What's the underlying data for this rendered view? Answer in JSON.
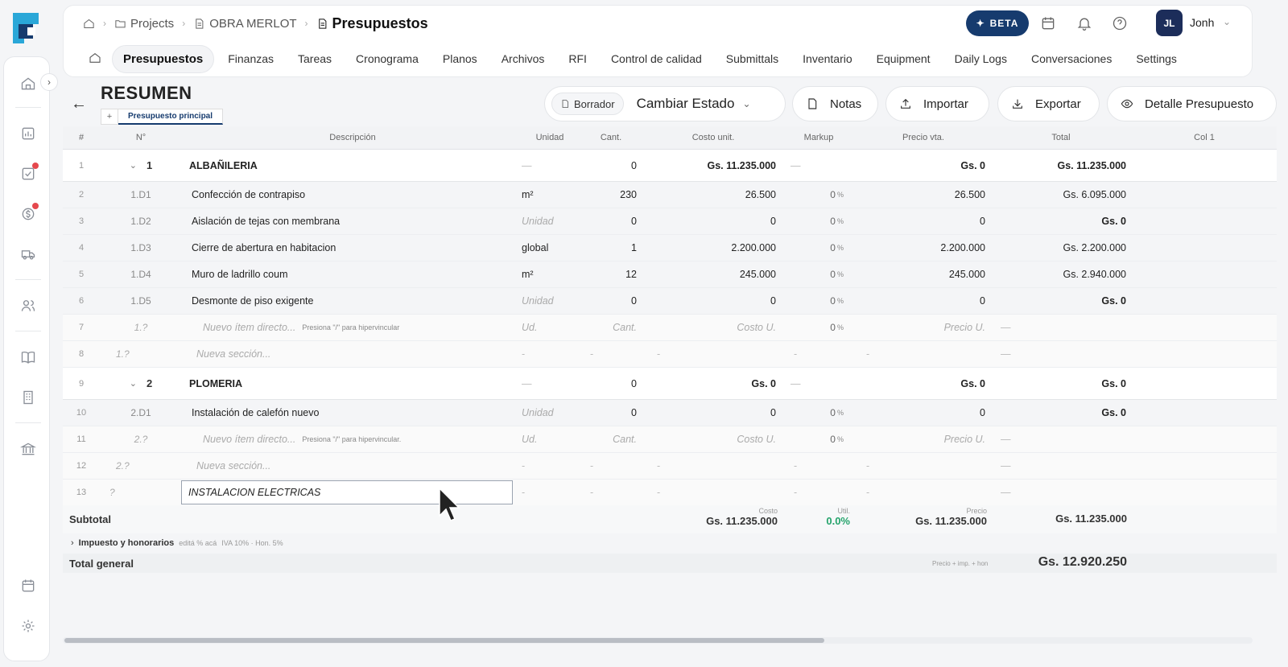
{
  "breadcrumb": {
    "projects": "Projects",
    "project": "OBRA MERLOT",
    "current": "Presupuestos"
  },
  "header": {
    "beta_label": "BETA",
    "avatar_initials": "JL",
    "user_name": "Jonh"
  },
  "tabs": [
    "Presupuestos",
    "Finanzas",
    "Tareas",
    "Cronograma",
    "Planos",
    "Archivos",
    "RFI",
    "Control de calidad",
    "Submittals",
    "Inventario",
    "Equipment",
    "Daily Logs",
    "Conversaciones",
    "Settings"
  ],
  "page": {
    "title": "RESUMEN",
    "subtab_add": "+",
    "subtab": "Presupuesto principal",
    "status_badge": "Borrador",
    "change_status": "Cambiar Estado"
  },
  "toolbar": {
    "notas": "Notas",
    "importar": "Importar",
    "exportar": "Exportar",
    "detalle": "Detalle Presupuesto"
  },
  "table": {
    "columns": {
      "idx": "#",
      "num": "N°",
      "desc": "Descripción",
      "unit": "Unidad",
      "cant": "Cant.",
      "costo": "Costo unit.",
      "markup": "Markup",
      "precio": "Precio vta.",
      "total": "Total",
      "col1": "Col 1"
    },
    "rows": [
      {
        "idx": "1",
        "num": "1",
        "desc": "ALBAÑILERIA",
        "unit": "—",
        "cant": "0",
        "costo": "Gs. 11.235.000",
        "markup": "—",
        "precio": "Gs. 0",
        "total": "Gs. 11.235.000"
      },
      {
        "idx": "2",
        "num": "1.D1",
        "desc": "Confección de contrapiso",
        "unit": "m²",
        "cant": "230",
        "costo": "26.500",
        "markup": "0",
        "precio": "26.500",
        "total": "Gs. 6.095.000"
      },
      {
        "idx": "3",
        "num": "1.D2",
        "desc": "Aislación de tejas con membrana",
        "unit": "Unidad",
        "cant": "0",
        "costo": "0",
        "markup": "0",
        "precio": "0",
        "total": "Gs. 0"
      },
      {
        "idx": "4",
        "num": "1.D3",
        "desc": "Cierre de abertura en habitacion",
        "unit": "global",
        "cant": "1",
        "costo": "2.200.000",
        "markup": "0",
        "precio": "2.200.000",
        "total": "Gs. 2.200.000"
      },
      {
        "idx": "5",
        "num": "1.D4",
        "desc": "Muro de ladrillo coum",
        "unit": "m²",
        "cant": "12",
        "costo": "245.000",
        "markup": "0",
        "precio": "245.000",
        "total": "Gs. 2.940.000"
      },
      {
        "idx": "6",
        "num": "1.D5",
        "desc": "Desmonte de piso exigente",
        "unit": "Unidad",
        "cant": "0",
        "costo": "0",
        "markup": "0",
        "precio": "0",
        "total": "Gs. 0"
      },
      {
        "idx": "7",
        "num": "1.?",
        "desc": "Nuevo ítem directo...",
        "hint": "Presiona \"/\" para hipervincular",
        "unit": "Ud.",
        "cant": "Cant.",
        "costo": "Costo U.",
        "markup": "0",
        "precio": "Precio U.",
        "total": "—"
      },
      {
        "idx": "8",
        "num": "1.?",
        "desc": "Nueva sección...",
        "unit": "-",
        "cant": "-",
        "costo": "-",
        "markup": "-",
        "precio": "-",
        "total": "—"
      },
      {
        "idx": "9",
        "num": "2",
        "desc": "PLOMERIA",
        "unit": "—",
        "cant": "0",
        "costo": "Gs. 0",
        "markup": "—",
        "precio": "Gs. 0",
        "total": "Gs. 0"
      },
      {
        "idx": "10",
        "num": "2.D1",
        "desc": "Instalación de calefón nuevo",
        "unit": "Unidad",
        "cant": "0",
        "costo": "0",
        "markup": "0",
        "precio": "0",
        "total": "Gs. 0"
      },
      {
        "idx": "11",
        "num": "2.?",
        "desc": "Nuevo ítem directo...",
        "hint": "Presiona \"/\" para hipervincular.",
        "unit": "Ud.",
        "cant": "Cant.",
        "costo": "Costo U.",
        "markup": "0",
        "precio": "Precio U.",
        "total": "—"
      },
      {
        "idx": "12",
        "num": "2.?",
        "desc": "Nueva sección...",
        "unit": "-",
        "cant": "-",
        "costo": "-",
        "markup": "-",
        "precio": "-",
        "total": "—"
      },
      {
        "idx": "13",
        "num": "?",
        "desc": "INSTALACION ELECTRICAS",
        "unit": "-",
        "cant": "-",
        "costo": "-",
        "markup": "-",
        "precio": "-",
        "total": "—"
      }
    ],
    "percent_sign": "%",
    "chevron": "⌄"
  },
  "subtotal": {
    "label": "Subtotal",
    "costo_cap": "Costo",
    "costo_val": "Gs. 11.235.000",
    "util_cap": "Util.",
    "util_val": "0.0%",
    "precio_cap": "Precio",
    "precio_val": "Gs. 11.235.000",
    "total_val": "Gs. 11.235.000"
  },
  "impuesto": {
    "label": "Impuesto y honorarios",
    "hint1": "editá % acá",
    "hint2": "IVA 10% · Hon. 5%"
  },
  "total_general": {
    "label": "Total general",
    "caption": "Precio + imp. + hon",
    "value": "Gs. 12.920.250"
  },
  "colors": {
    "brand": "#163b6e",
    "green": "#24a36b",
    "alert": "#e5484d"
  }
}
